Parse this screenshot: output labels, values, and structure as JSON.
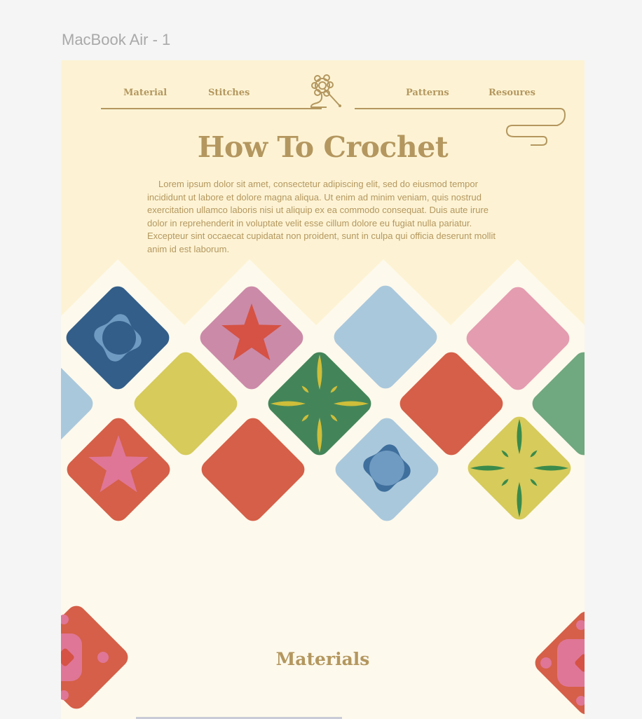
{
  "frame": {
    "label": "MacBook Air - 1"
  },
  "colors": {
    "canvas": "#f5f5f5",
    "page": "#fdf9ec",
    "hero": "#fdf3d4",
    "text": "#b4975f",
    "navy": "#335e89",
    "mauve": "#cb8aa8",
    "light_blue": "#aac8dc",
    "pink": "#e49cb0",
    "mustard": "#d6cb5b",
    "forest": "#438559",
    "red": "#d55f48",
    "sage": "#70a87f",
    "blue": "#3f6f9c",
    "star_red": "#d55244",
    "star_pink": "#df7697"
  },
  "nav": {
    "left": [
      "Material",
      "Stitches"
    ],
    "right": [
      "Patterns",
      "Resoures"
    ],
    "logo_icon": "yarn-ball-crochet-hook-icon"
  },
  "hero": {
    "title": "How To Crochet",
    "body": "Lorem ipsum dolor sit amet, consectetur adipiscing elit, sed do eiusmod tempor incididunt ut labore et dolore magna aliqua. Ut enim ad minim veniam, quis nostrud exercitation ullamco laboris nisi ut aliquip ex ea commodo consequat. Duis aute irure dolor in reprehenderit in voluptate velit esse cillum dolore eu fugiat nulla pariatur. Excepteur sint occaecat cupidatat non proident, sunt in culpa qui officia deserunt mollit anim id est laborum."
  },
  "granny_squares": [
    {
      "color": "navy",
      "motif": "flower-icon"
    },
    {
      "color": "mauve",
      "motif": "star-icon"
    },
    {
      "color": "light_blue",
      "motif": "none"
    },
    {
      "color": "pink",
      "motif": "none"
    },
    {
      "color": "light_blue",
      "motif": "none"
    },
    {
      "color": "mustard",
      "motif": "none"
    },
    {
      "color": "forest",
      "motif": "compass-star-icon"
    },
    {
      "color": "red",
      "motif": "none"
    },
    {
      "color": "sage",
      "motif": "none"
    },
    {
      "color": "red",
      "motif": "star-icon"
    },
    {
      "color": "red",
      "motif": "none"
    },
    {
      "color": "light_blue",
      "motif": "flower-icon"
    },
    {
      "color": "mustard",
      "motif": "compass-star-icon"
    }
  ],
  "materials": {
    "title": "Materials",
    "corner_motif": "granny-square-motif-icon"
  }
}
